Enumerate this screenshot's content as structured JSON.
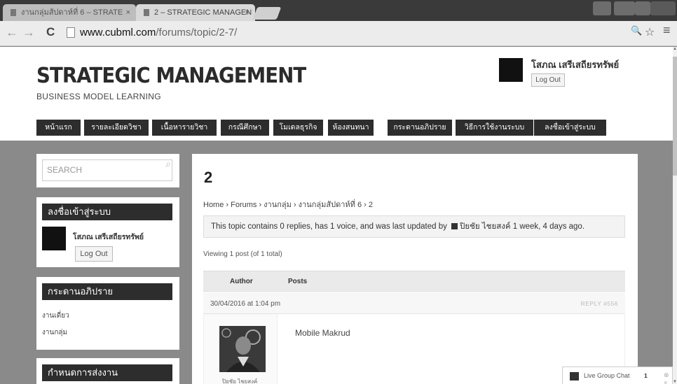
{
  "browser": {
    "tabs": [
      {
        "title": "งานกลุ่มสัปดาห์ที่ 6 – STRATE",
        "close": "×",
        "active": false
      },
      {
        "title": "2 – STRATEGIC MANAGEN",
        "close": "×",
        "active": true
      }
    ],
    "url_host": "www.cubml.com",
    "url_path": "/forums/topic/2-7/",
    "nav_back": "←",
    "nav_forward": "→",
    "reload": "C",
    "zoom_icon": "🔍",
    "star_icon": "☆",
    "menu_icon": "≡"
  },
  "site": {
    "title": "STRATEGIC MANAGEMENT",
    "tagline": "BUSINESS MODEL LEARNING",
    "user_name": "โสภณ เสรีเสถียรทรัพย์",
    "logout_label": "Log Out"
  },
  "nav": {
    "items": [
      "หน้าแรก",
      "รายละเอียดวิชา",
      "เนื้อหารายวิชา",
      "กรณีศึกษา",
      "โมเดลธุรกิจ",
      "ห้องสนทนา",
      "กระดานอภิปราย",
      "วิธีการใช้งานระบบ",
      "ลงชื่อเข้าสู่ระบบ"
    ]
  },
  "sidebar": {
    "search_placeholder": "SEARCH",
    "login_widget": {
      "title": "ลงชื่อเข้าสู่ระบบ",
      "user_name": "โสภณ เสรีเสถียรทรัพย์",
      "logout_label": "Log Out"
    },
    "forum_widget": {
      "title": "กระดานอภิปราย",
      "links": [
        "งานเดี่ยว",
        "งานกลุ่ม"
      ]
    },
    "deadline_widget": {
      "title": "กำหนดการส่งงาน"
    }
  },
  "main": {
    "topic_title": "2",
    "breadcrumb": "Home › Forums › งานกลุ่ม › งานกลุ่มสัปดาห์ที่ 6 › 2",
    "notice_prefix": "This topic contains 0 replies, has 1 voice, and was last updated by",
    "notice_user": "ปิยชัย ไชยสงค์",
    "notice_time": "1 week, 4 days ago.",
    "viewing": "Viewing 1 post (of 1 total)",
    "col_author": "Author",
    "col_posts": "Posts",
    "post": {
      "date": "30/04/2016 at 1:04 pm",
      "actions": "REPLY  #556",
      "author": "ปิยชัย ไชยสงค์",
      "text": "Mobile Makrud"
    }
  },
  "chat": {
    "label": "Live Group Chat",
    "count": "1",
    "extra": "⊗ ×"
  }
}
